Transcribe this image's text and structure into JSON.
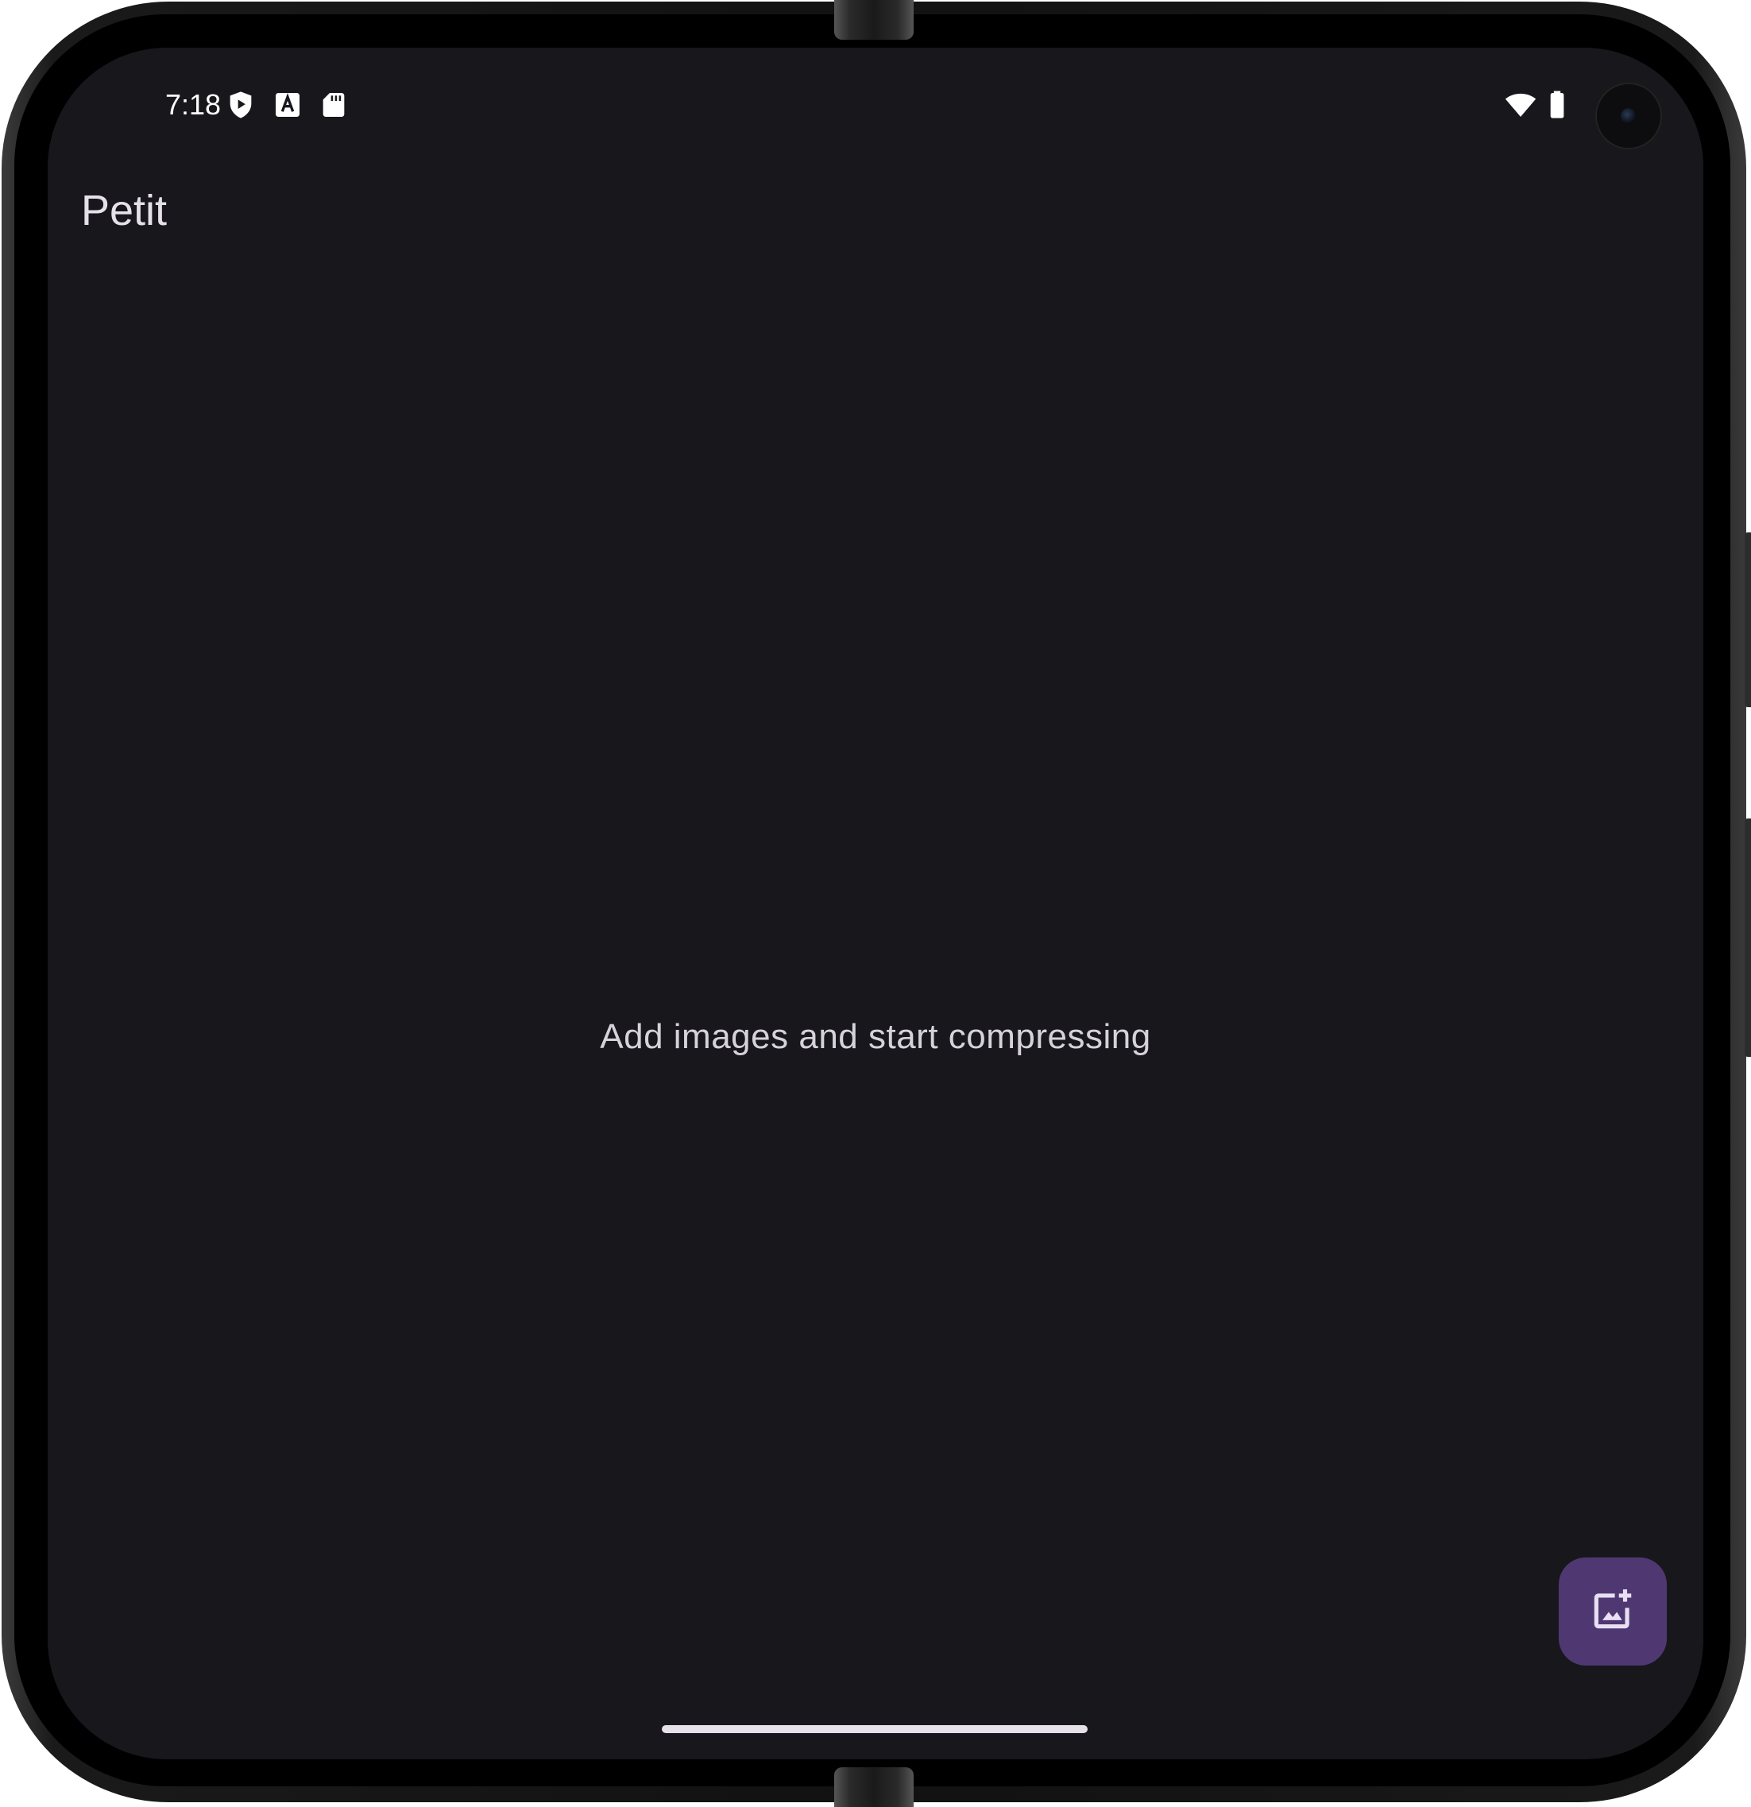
{
  "status_bar": {
    "time": "7:18",
    "left_icons": [
      "shield-play-icon",
      "font-a-icon",
      "sd-card-icon"
    ],
    "right_icons": [
      "wifi-icon",
      "battery-icon"
    ]
  },
  "app": {
    "title": "Petit",
    "empty_message": "Add images and start compressing",
    "fab_icon": "add-photo-icon"
  },
  "colors": {
    "background": "#18171c",
    "fab": "#4f3872",
    "text": "#e6e1e9"
  }
}
